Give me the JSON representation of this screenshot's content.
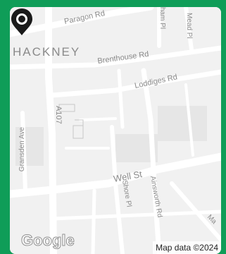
{
  "map": {
    "district_label": "HACKNEY",
    "streets": {
      "paragon": "Paragon Rd",
      "brenthouse": "Brenthouse Rd",
      "loddiges": "Loddiges Rd",
      "a107": "A107",
      "gransden": "Gransden Ave",
      "well": "Well St",
      "shore": "Shore Pl",
      "ainsworth": "Ainsworth Rd",
      "mead": "Mead Pl",
      "ham": "ham Pl",
      "ma": "Ma"
    },
    "logo_text": "Google",
    "attribution": "Map data ©2024",
    "marker_icon": "location-pin-icon",
    "colors": {
      "frame": "#0f9d58",
      "map_bg": "#f1f1f1",
      "road": "#ffffff",
      "marker": "#1a1a1a"
    }
  }
}
